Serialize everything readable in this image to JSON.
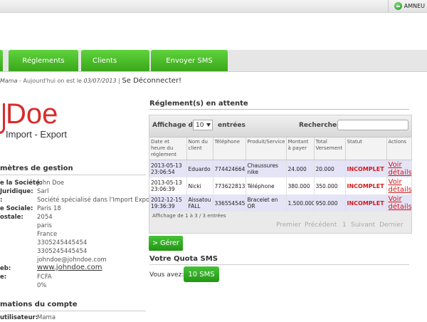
{
  "user": {
    "name": "AMNEU"
  },
  "nav": {
    "tabs": [
      "Réglements",
      "Clients",
      "Envoyer SMS"
    ]
  },
  "breadcrumb": {
    "user": "Mama",
    "prefix": " - Aujourd'hui on est le ",
    "date": "03/07/2013",
    "sep": " | ",
    "logout": "Se Déconnecter!"
  },
  "logo": {
    "name": "Doe",
    "subtitle": "Import - Export"
  },
  "company": {
    "section_title": "mètres de gestion",
    "rows": [
      {
        "label": "e la Société:",
        "value": "John Doe"
      },
      {
        "label": "Juridique:",
        "value": "Sarl"
      },
      {
        "label": ":",
        "value": "Société spécialisé dans l'Import Export"
      },
      {
        "label": "e Sociale:",
        "value": "Paris 18"
      },
      {
        "label": "ostale:",
        "value": "2054"
      },
      {
        "label": "",
        "value": "paris"
      },
      {
        "label": "",
        "value": "France"
      },
      {
        "label": "",
        "value": "3305245445454"
      },
      {
        "label": "",
        "value": "3305245445454"
      },
      {
        "label": "",
        "value": "johndoe@johndoe.com"
      },
      {
        "label": "eb:",
        "value": "www.johndoe.com"
      },
      {
        "label": "e:",
        "value": "FCFA"
      },
      {
        "label": "",
        "value": "0%"
      }
    ]
  },
  "account": {
    "section_title": "mations du compte",
    "partial_label": "utilisateur:",
    "partial_value": "Mama"
  },
  "payments": {
    "title": "Réglement(s) en attente",
    "show_label": "Affichage de",
    "page_size": "10",
    "entries_label": "entrées",
    "search_label": "Rechercher:",
    "search_value": "",
    "columns": [
      "Date et heure du réglement",
      "Nom du client",
      "Téléphone",
      "Produit/Service",
      "Montant à payer",
      "Total Versement",
      "Statut",
      "Actions"
    ],
    "rows": [
      {
        "date": "2013-05-13 23:06:54",
        "client": "Eduardo",
        "phone": "774424664",
        "product": "Chaussures nike",
        "amount": "24.000",
        "total": "20.000",
        "status": "INCOMPLET",
        "action": "Voir détails"
      },
      {
        "date": "2013-05-13 23:06:39",
        "client": "Nicki",
        "phone": "773622813",
        "product": "Téléphone",
        "amount": "380.000",
        "total": "350.000",
        "status": "INCOMPLET",
        "action": "Voir détails"
      },
      {
        "date": "2012-12-15 19:36:39",
        "client": "Aissatou FALL",
        "phone": "3365545455",
        "product": "Bracelet en OR",
        "amount": "1.500.000",
        "total": "950.000",
        "status": "INCOMPLET",
        "action": "Voir détails"
      }
    ],
    "info": "Affichage de 1 à 3 / 3 entrées",
    "pager": {
      "first": "Premier",
      "prev": "Précédent",
      "page": "1",
      "next": "Suivant",
      "last": "Dernier"
    },
    "manage_button": "> Gérer"
  },
  "quota": {
    "title": "Votre Quota SMS",
    "label": "Vous avez:",
    "value": "10 SMS"
  },
  "colors": {
    "green": "#3aa71a",
    "red": "#d92b2b",
    "status_red": "#d01a1a"
  }
}
